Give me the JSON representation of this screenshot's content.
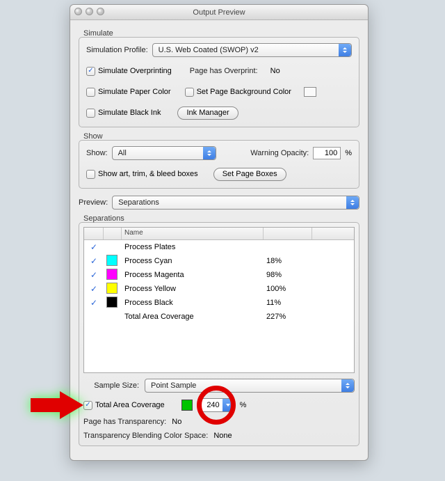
{
  "window": {
    "title": "Output Preview"
  },
  "simulate": {
    "legend": "Simulate",
    "profile_label": "Simulation Profile:",
    "profile_value": "U.S. Web Coated (SWOP) v2",
    "overprint_label": "Simulate Overprinting",
    "page_has_overprint_label": "Page has Overprint:",
    "page_has_overprint_value": "No",
    "paper_color_label": "Simulate Paper Color",
    "set_bg_label": "Set Page Background Color",
    "black_ink_label": "Simulate Black Ink",
    "ink_manager_btn": "Ink Manager"
  },
  "show_group": {
    "legend": "Show",
    "show_label": "Show:",
    "show_value": "All",
    "warning_opacity_label": "Warning Opacity:",
    "warning_opacity_value": "100",
    "warning_opacity_unit": "%",
    "show_boxes_label": "Show art, trim, & bleed boxes",
    "set_page_boxes_btn": "Set Page Boxes"
  },
  "preview": {
    "label": "Preview:",
    "value": "Separations"
  },
  "separations": {
    "legend": "Separations",
    "header_name": "Name",
    "rows": [
      {
        "color": null,
        "name": "Process Plates",
        "percent": ""
      },
      {
        "color": "#00ffff",
        "name": "Process Cyan",
        "percent": "18%"
      },
      {
        "color": "#ff00ff",
        "name": "Process Magenta",
        "percent": "98%"
      },
      {
        "color": "#ffff00",
        "name": "Process Yellow",
        "percent": "100%"
      },
      {
        "color": "#000000",
        "name": "Process Black",
        "percent": "11%"
      },
      {
        "color": null,
        "name": "Total Area Coverage",
        "percent": "227%"
      }
    ]
  },
  "bottom": {
    "sample_size_label": "Sample Size:",
    "sample_size_value": "Point Sample",
    "tac_label": "Total Area Coverage",
    "tac_value": "240",
    "tac_unit": "%",
    "page_transparency_label": "Page has Transparency:",
    "page_transparency_value": "No",
    "blend_space_label": "Transparency Blending Color Space:",
    "blend_space_value": "None"
  }
}
